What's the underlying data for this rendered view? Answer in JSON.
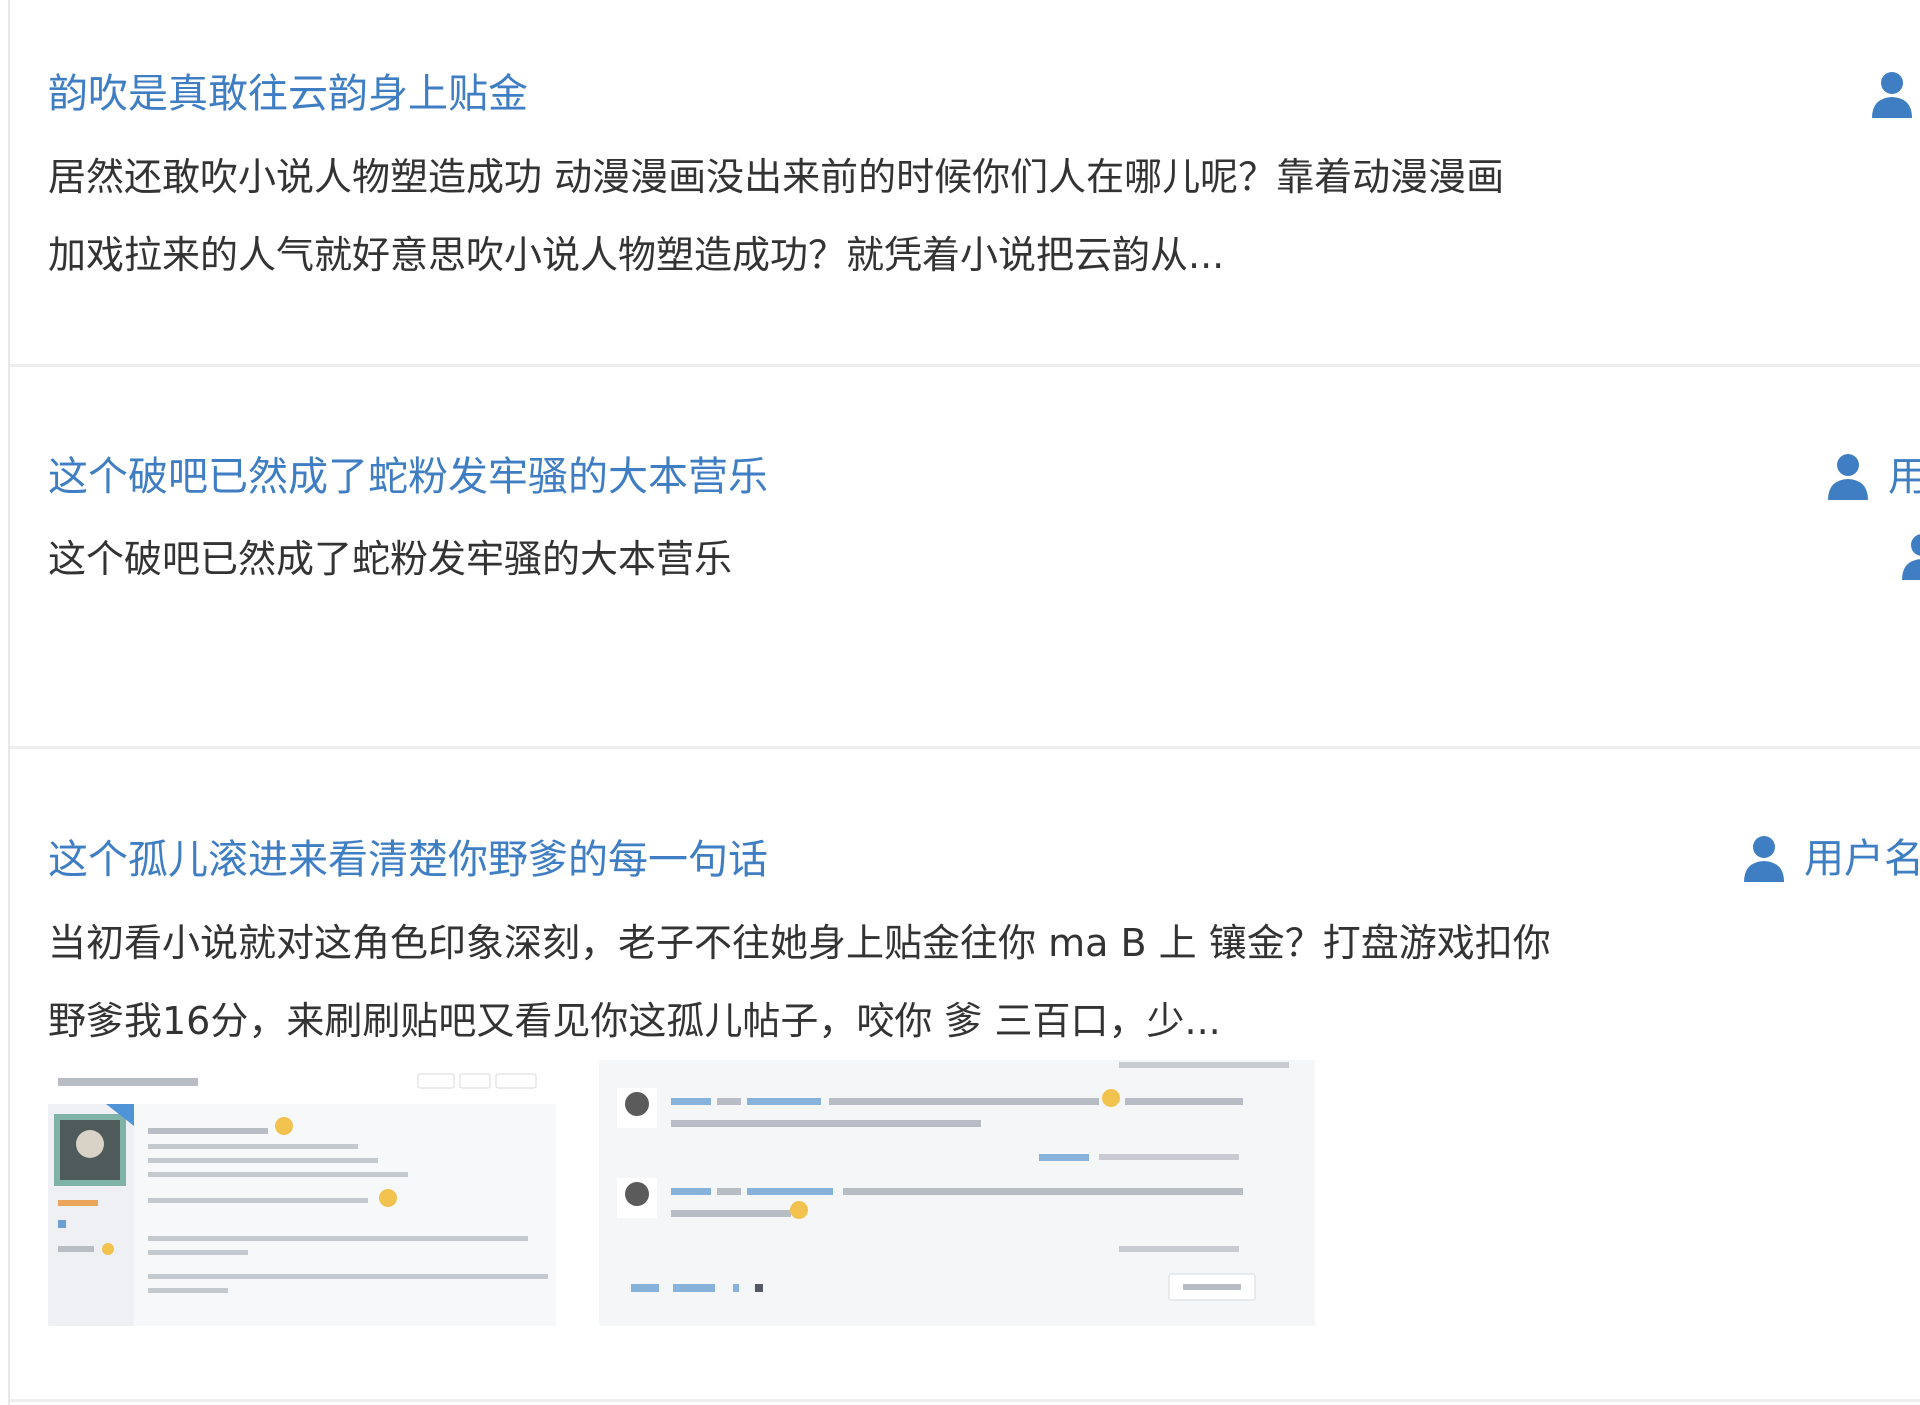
{
  "posts": [
    {
      "title": "韵吹是真敢往云韵身上贴金",
      "excerpt_line1": "居然还敢吹小说人物塑造成功 动漫漫画没出来前的时候你们人在哪儿呢？靠着动漫漫画",
      "excerpt_line2": "加戏拉来的人气就好意思吹小说人物塑造成功？就凭着小说把云韵从...",
      "author_icon": "user-icon"
    },
    {
      "title": "这个破吧已然成了蛇粉发牢骚的大本营乐",
      "excerpt_line1": "这个破吧已然成了蛇粉发牢骚的大本营乐",
      "author_label": "用",
      "author_icon": "user-icon"
    },
    {
      "title": "这个孤儿滚进来看清楚你野爹的每一句话",
      "excerpt_line1": "当初看小说就对这角色印象深刻，老子不往她身上贴金往你 ma B 上 镶金？打盘游戏扣你",
      "excerpt_line2": "野爹我16分，来刷刷贴吧又看见你这孤儿帖子，咬你 爹 三百口，少...",
      "author_label": "用户名",
      "author_icon": "user-icon",
      "thumbnails": [
        {
          "alt": "帖子截图1",
          "name": "screenshot-thumbnail-1"
        },
        {
          "alt": "帖子截图2",
          "name": "screenshot-thumbnail-2"
        }
      ]
    }
  ],
  "colors": {
    "link": "#3f7ec3",
    "text": "#333333",
    "separator": "#eeeeee"
  }
}
